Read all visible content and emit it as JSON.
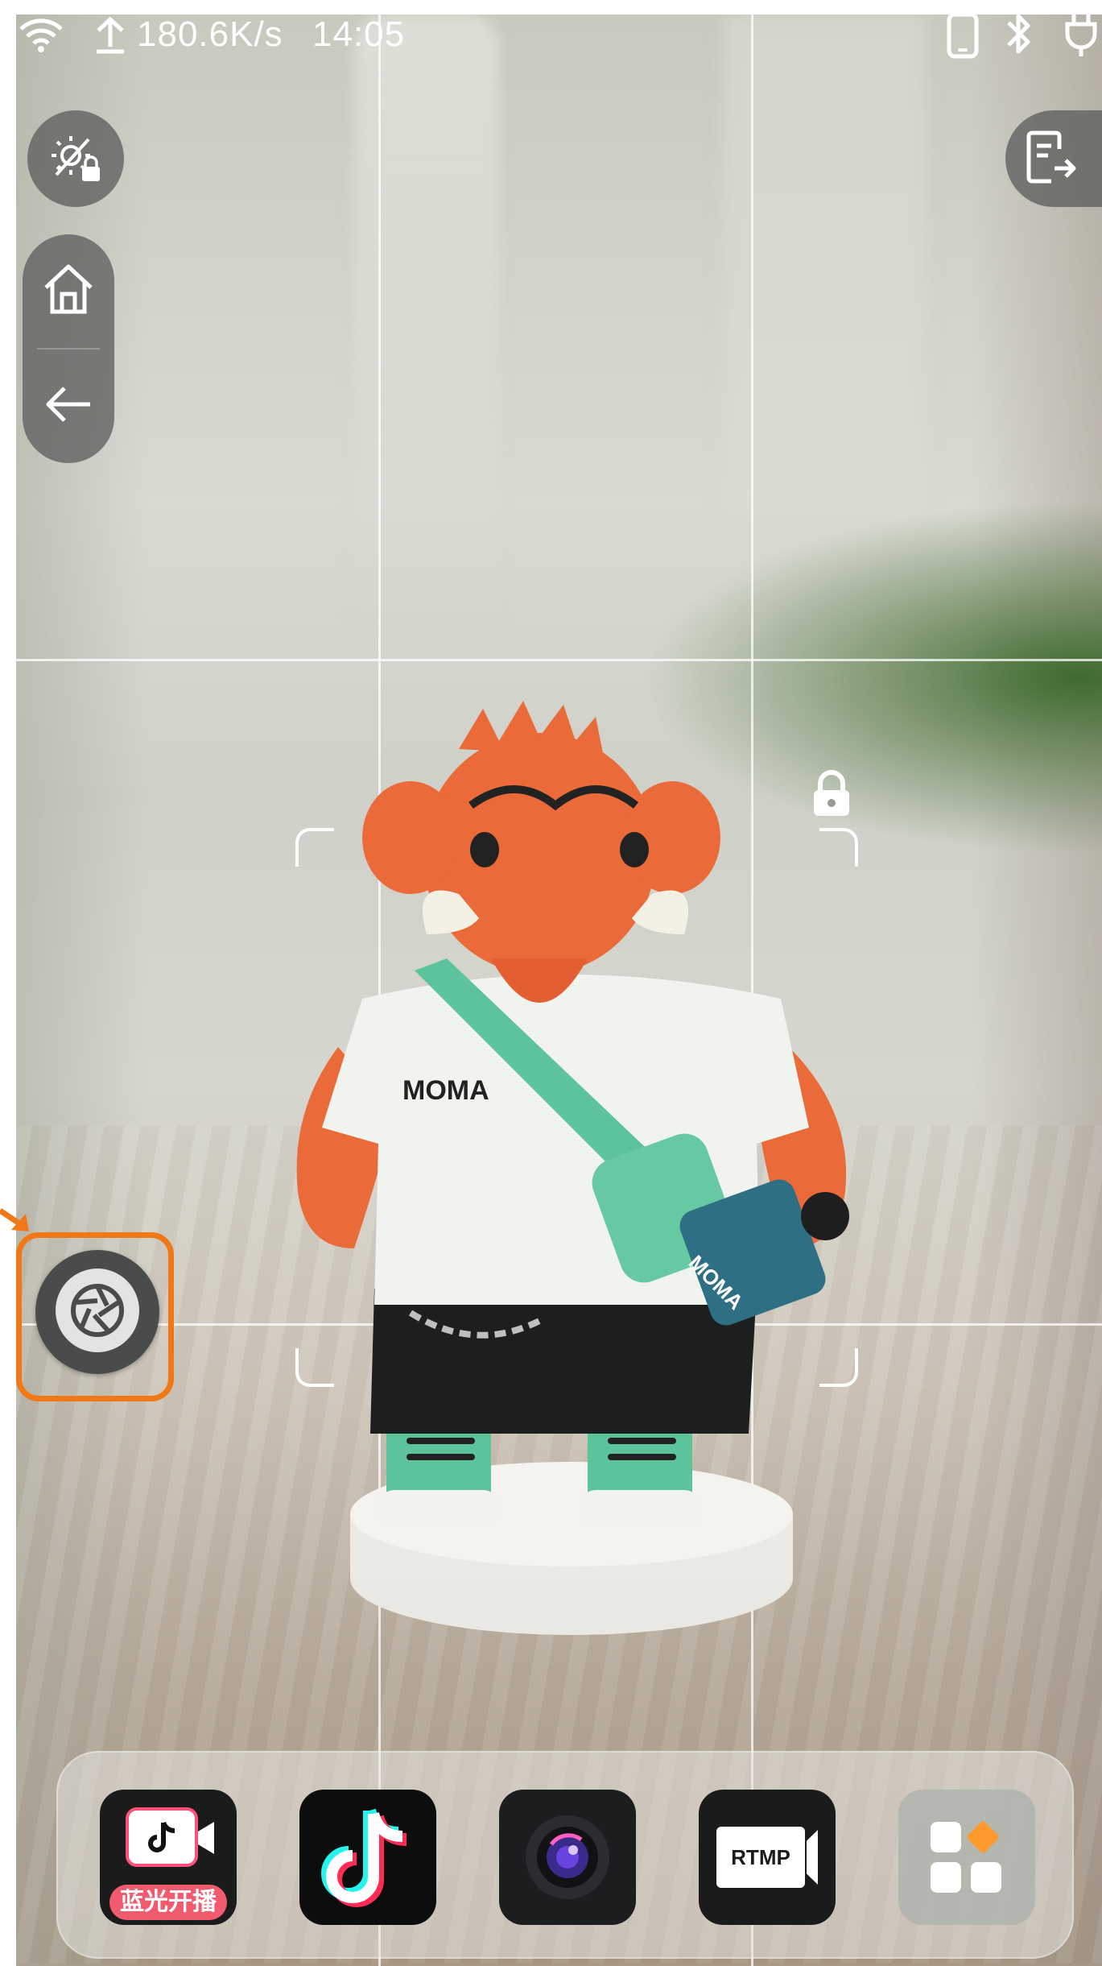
{
  "status_bar": {
    "network_speed": "180.6K/s",
    "time": "14:05"
  },
  "controls": {
    "brightness_lock": "brightness-lock-icon",
    "home": "home-icon",
    "back": "back-arrow-icon",
    "exit": "exit-document-icon",
    "shutter": "shutter-aperture-icon",
    "focus_lock": "lock-icon"
  },
  "figure": {
    "shirt_text": "MOMA",
    "bag_text": "MOMA"
  },
  "dock": {
    "apps": [
      {
        "id": "lanyguang-live",
        "label": "蓝光开播"
      },
      {
        "id": "douyin",
        "label": ""
      },
      {
        "id": "camera",
        "label": ""
      },
      {
        "id": "rtmp",
        "label": "RTMP"
      },
      {
        "id": "app-drawer",
        "label": ""
      }
    ]
  },
  "colors": {
    "accent_orange": "#f07816",
    "dock_bg": "#e6e6e2",
    "figure_orange": "#ea6a3a",
    "figure_green": "#5dc39a"
  }
}
